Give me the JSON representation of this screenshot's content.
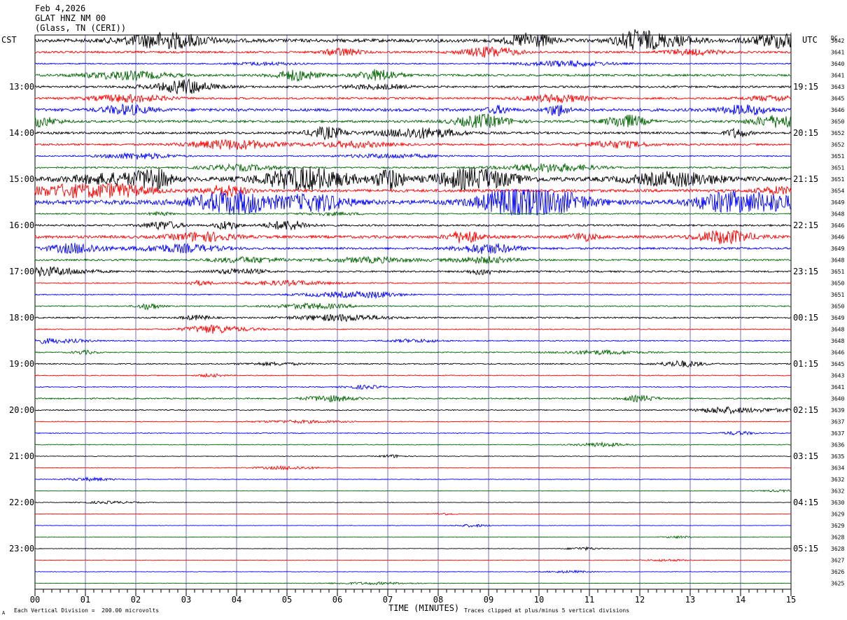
{
  "header": {
    "date": "Feb 4,2026",
    "station": "GLAT HNZ NM 00",
    "location": "(Glass, TN (CERI))"
  },
  "labels": {
    "left_tz": "CST",
    "right_tz": "UTC",
    "dc_heading": "DC",
    "x_title": "TIME (MINUTES)",
    "footer_left": "Each Vertical Division =  200.00 microvolts",
    "footer_right": "Traces clipped at plus/minus 5 vertical divisions",
    "footer_mark": "A"
  },
  "chart_data": {
    "type": "line",
    "title": "GLAT HNZ NM 00",
    "xlabel": "TIME (MINUTES)",
    "xlim": [
      0,
      15
    ],
    "x_ticks": [
      "00",
      "01",
      "02",
      "03",
      "04",
      "05",
      "06",
      "07",
      "08",
      "09",
      "10",
      "11",
      "12",
      "13",
      "14",
      "15"
    ],
    "trace_colors": [
      "#000000",
      "#ff0000",
      "#0000ff",
      "#006400"
    ],
    "grid_color": "#7070c0",
    "left_hour_labels": [
      "13:00",
      "14:00",
      "15:00",
      "16:00",
      "17:00",
      "18:00",
      "19:00",
      "20:00",
      "21:00",
      "22:00",
      "23:00"
    ],
    "right_hour_labels": [
      "19:15",
      "20:15",
      "21:15",
      "22:15",
      "23:15",
      "00:15",
      "01:15",
      "02:15",
      "03:15",
      "04:15",
      "05:15"
    ],
    "dc_offsets": [
      "3642",
      "3641",
      "3640",
      "3641",
      "3643",
      "3645",
      "3646",
      "3650",
      "3652",
      "3652",
      "3651",
      "3651",
      "3651",
      "3654",
      "3649",
      "3648",
      "3646",
      "3646",
      "3649",
      "3648",
      "3651",
      "3650",
      "3651",
      "3650",
      "3649",
      "3648",
      "3648",
      "3646",
      "3645",
      "3643",
      "3641",
      "3640",
      "3639",
      "3637",
      "3637",
      "3636",
      "3635",
      "3634",
      "3632",
      "3632",
      "3630",
      "3629",
      "3629",
      "3628",
      "3628",
      "3627",
      "3626",
      "3625"
    ],
    "trace_activity": [
      2.6,
      1.6,
      0.9,
      1.6,
      1.5,
      1.5,
      2.2,
      1.8,
      1.7,
      1.5,
      0.9,
      1.2,
      3.2,
      2.2,
      3.5,
      0.9,
      1.4,
      2.2,
      1.6,
      1.3,
      1.3,
      0.8,
      0.8,
      0.9,
      1.1,
      0.8,
      0.8,
      0.8,
      0.9,
      0.7,
      0.7,
      1.0,
      0.8,
      0.6,
      0.6,
      0.6,
      0.5,
      0.5,
      0.5,
      0.4,
      0.4,
      0.4,
      0.4,
      0.4,
      0.4,
      0.4,
      0.4,
      0.4
    ]
  }
}
